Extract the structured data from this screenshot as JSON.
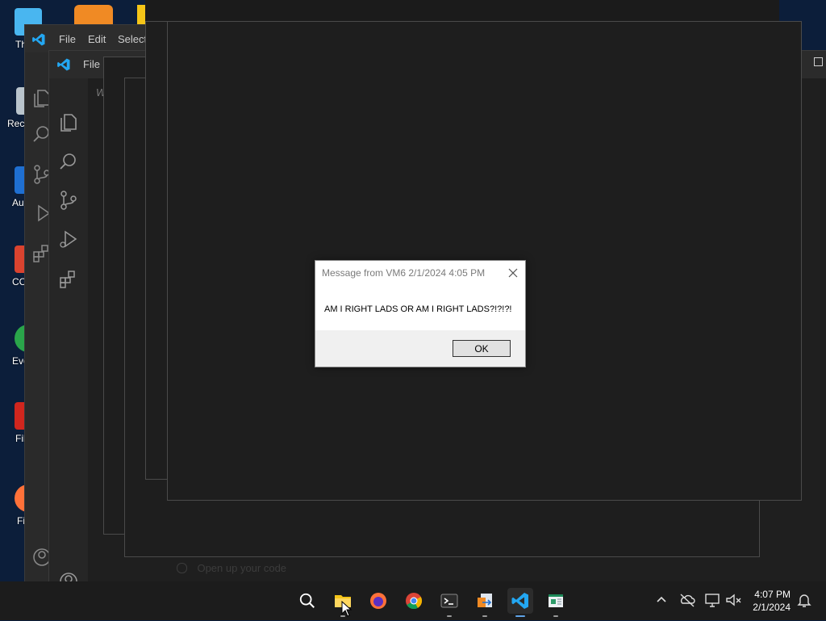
{
  "desktop": {
    "icons": [
      {
        "name": "this-pc",
        "label": "Th",
        "color": "#49b6f0"
      },
      {
        "name": "recycle-bin",
        "label": "Recy",
        "color": "#b9c4cc"
      },
      {
        "name": "shortcut-au",
        "label": "Au",
        "color": "#1f6fd1"
      },
      {
        "name": "shortcut-cc",
        "label": "CC",
        "color": "#d9432f"
      },
      {
        "name": "shortcut-eve",
        "label": "Eve",
        "color": "#2aa54a"
      },
      {
        "name": "shortcut-fil",
        "label": "Fil",
        "color": "#d0261e"
      },
      {
        "name": "shortcut-fi",
        "label": "Fi",
        "color": "#ff7139"
      }
    ]
  },
  "vscode_back": {
    "menu": [
      "File",
      "Edit",
      "Selecti"
    ]
  },
  "vscode_front": {
    "menu": [
      "File"
    ],
    "welcome_partial": "W",
    "walkthrough_item": "Open up your code"
  },
  "dialog": {
    "title": "Message from VM6 2/1/2024 4:05 PM",
    "message": "AM I RIGHT LADS OR AM I RIGHT LADS?!?!?!",
    "ok_label": "OK"
  },
  "taskbar": {
    "apps": [
      "search-icon",
      "file-explorer-icon",
      "firefox-icon",
      "chrome-icon",
      "terminal-icon",
      "file-transfer-icon",
      "vscode-icon",
      "notepad-icon"
    ],
    "active_app": "vscode-icon",
    "clock_time": "4:07 PM",
    "clock_date": "2/1/2024"
  },
  "colors": {
    "vscode_blue": "#23a7f2",
    "desktop_bg": "#0c1e3a",
    "taskbar_bg": "#1c1c1c"
  }
}
